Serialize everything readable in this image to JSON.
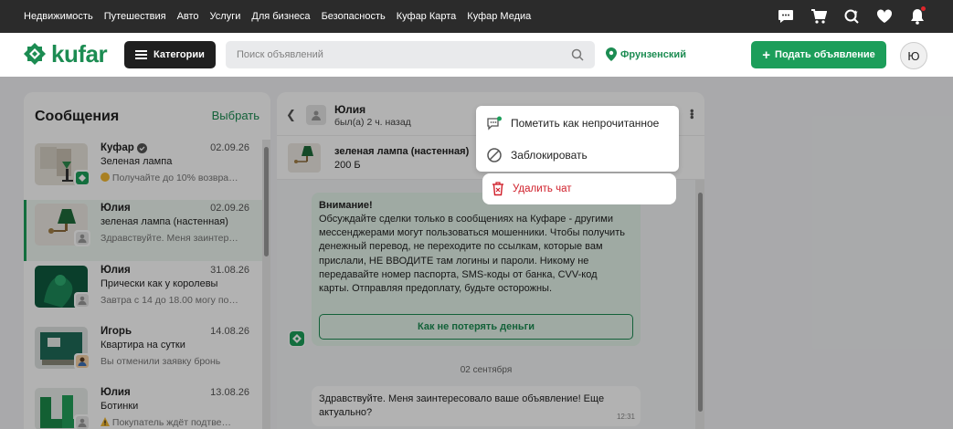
{
  "topbar": {
    "links": [
      "Недвижимость",
      "Путешествия",
      "Авто",
      "Услуги",
      "Для бизнеса",
      "Безопасность",
      "Куфар Карта",
      "Куфар Медиа"
    ],
    "icons": [
      "chat-icon",
      "cart-icon",
      "saved-search-icon",
      "heart-icon",
      "bell-icon"
    ]
  },
  "header": {
    "logo": "kufar",
    "categories_label": "Категории",
    "search_placeholder": "Поиск объявлений",
    "location": "Фрунзенский",
    "post_label": "Подать объявление",
    "avatar_letter": "Ю"
  },
  "sidebar": {
    "title": "Сообщения",
    "select_label": "Выбрать",
    "conversations": [
      {
        "name": "Куфар",
        "date": "02.09.26",
        "subject": "Зеленая лампа",
        "preview": "Получайте до 10% возвра…",
        "verified": true,
        "preview_icon": "emoji-icon"
      },
      {
        "name": "Юлия",
        "date": "02.09.26",
        "subject": "зеленая лампа (настенная)",
        "preview": "Здравствуйте. Меня заинтер…",
        "active": true
      },
      {
        "name": "Юлия",
        "date": "31.08.26",
        "subject": "Прически как у королевы",
        "preview": "Завтра с 14 до 18.00 могу по…"
      },
      {
        "name": "Игорь",
        "date": "14.08.26",
        "subject": "Квартира на сутки",
        "preview": "Вы отменили заявку бронь"
      },
      {
        "name": "Юлия",
        "date": "13.08.26",
        "subject": "Ботинки",
        "preview": "Покупатель ждёт подтве…",
        "preview_icon": "warning-icon"
      }
    ]
  },
  "chat": {
    "name": "Юлия",
    "status": "был(а) 2 ч. назад",
    "item_title": "зеленая лампа (настенная)",
    "item_price": "200 Б",
    "warning_title": "Внимание!",
    "warning_text": "Обсуждайте сделки только в сообщениях на Куфаре - другими мессенджерами могут пользоваться мошенники. Чтобы получить денежный перевод, не переходите по ссылкам, которые вам прислали, НЕ ВВОДИТЕ там логины и пароли. Никому не передавайте номер паспорта, SMS-коды от банка, CVV-код карты. Отправляя предоплату, будьте осторожны.",
    "warning_button": "Как не потерять деньги",
    "date_separator": "02 сентября",
    "message_text": "Здравствуйте. Меня заинтересовало ваше объявление! Еще актуально?",
    "message_time": "12:31"
  },
  "menu": {
    "mark_unread": "Пометить как непрочитанное",
    "block": "Заблокировать",
    "delete": "Удалить чат"
  },
  "colors": {
    "brand_green": "#1c8c52",
    "danger_red": "#d0202b",
    "dark": "#2b2b2b"
  }
}
